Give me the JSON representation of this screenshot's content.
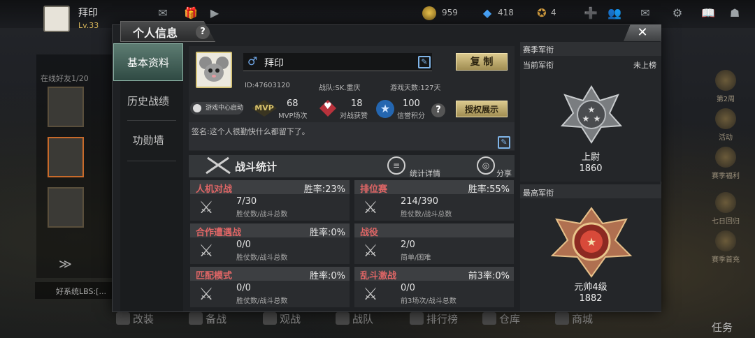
{
  "header": {
    "player_name": "拜印",
    "player_level": "Lv.33",
    "gold": "959",
    "diamond": "418",
    "tickets": "4"
  },
  "left_rail": {
    "friends_online": "在线好友1/20",
    "chat_text": "好系统LBS:[..."
  },
  "modal": {
    "title": "个人信息",
    "help": "?",
    "close": "✕",
    "tabs": [
      "基本资料",
      "历史战绩",
      "功勋墙"
    ],
    "profile": {
      "name": "拜印",
      "gender": "♂",
      "copy_label": "复 制",
      "id_text": "ID:47603120",
      "team_text": "战队:SK.重庆",
      "days_text": "游戏天数:127天",
      "game_center": "游戏中心启动",
      "mvp_icon": "MVP",
      "mvp_value": "68",
      "mvp_label": "MVP场次",
      "wins_value": "18",
      "wins_label": "对战获赞",
      "credit_value": "100",
      "credit_label": "信誉积分",
      "auth_label": "授权展示",
      "signature": "签名:这个人很勤快什么都留下了。"
    },
    "battle": {
      "title": "战斗统计",
      "detail_label": "统计详情",
      "share_label": "分享"
    },
    "modes": [
      {
        "name": "人机对战",
        "rate": "胜率:23%",
        "value": "7/30",
        "sub": "胜仗数/战斗总数"
      },
      {
        "name": "排位赛",
        "rate": "胜率:55%",
        "value": "214/390",
        "sub": "胜仗数/战斗总数"
      },
      {
        "name": "合作遭遇战",
        "rate": "胜率:0%",
        "value": "0/0",
        "sub": "胜仗数/战斗总数"
      },
      {
        "name": "战役",
        "rate": "",
        "value": "2/0",
        "sub": "简单/困难"
      },
      {
        "name": "匹配模式",
        "rate": "胜率:0%",
        "value": "0/0",
        "sub": "胜仗数/战斗总数"
      },
      {
        "name": "乱斗激战",
        "rate": "前3率:0%",
        "value": "0/0",
        "sub": "前3场次/战斗总数"
      }
    ],
    "season_rank": {
      "title": "赛季军衔",
      "current_label": "当前军衔",
      "not_ranked": "未上榜",
      "rank_name": "上尉",
      "rank_score": "1860"
    },
    "highest_rank": {
      "title": "最高军衔",
      "rank_name": "元帅4级",
      "rank_score": "1882"
    }
  },
  "right_rail": [
    "第2周",
    "活动",
    "赛季福利",
    "七日回归",
    "赛季首充"
  ],
  "bottom_nav": [
    "改装",
    "备战",
    "观战",
    "战队",
    "排行榜",
    "仓库",
    "商城"
  ],
  "task_label": "任务",
  "colors": {
    "accent_gold": "#d7c57a",
    "mode_name_red": "#e06666",
    "active_tab_teal": "#5d7c72"
  }
}
